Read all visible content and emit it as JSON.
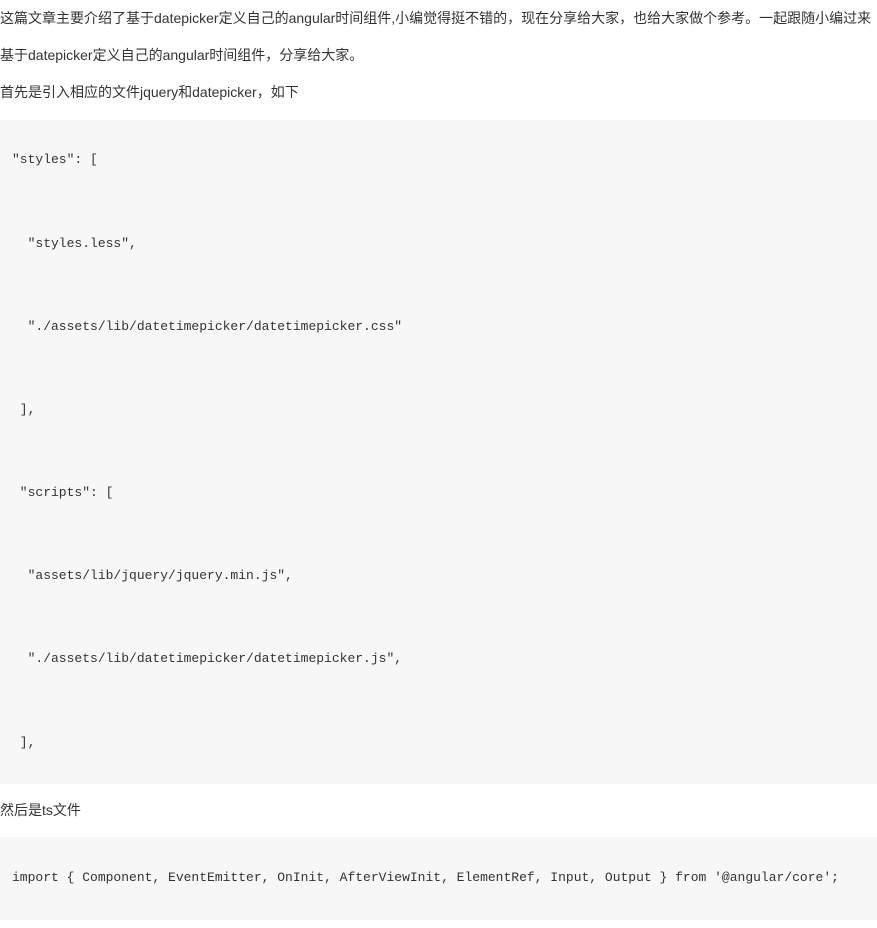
{
  "paragraphs": {
    "p1": "这篇文章主要介绍了基于datepicker定义自己的angular时间组件,小编觉得挺不错的，现在分享给大家，也给大家做个参考。一起跟随小编过来",
    "p2": "基于datepicker定义自己的angular时间组件，分享给大家。",
    "p3": "首先是引入相应的文件jquery和datepicker，如下",
    "p4": "然后是ts文件"
  },
  "code1": {
    "l1": "\"styles\": [",
    "l2": "  \"styles.less\",",
    "l3": "  \"./assets/lib/datetimepicker/datetimepicker.css\"",
    "l4": " ],",
    "l5": " \"scripts\": [",
    "l6": "  \"assets/lib/jquery/jquery.min.js\",",
    "l7": "  \"./assets/lib/datetimepicker/datetimepicker.js\",",
    "l8": " ],"
  },
  "code2": {
    "l1": "import { Component, EventEmitter, OnInit, AfterViewInit, ElementRef, Input, Output } from '@angular/core';"
  }
}
